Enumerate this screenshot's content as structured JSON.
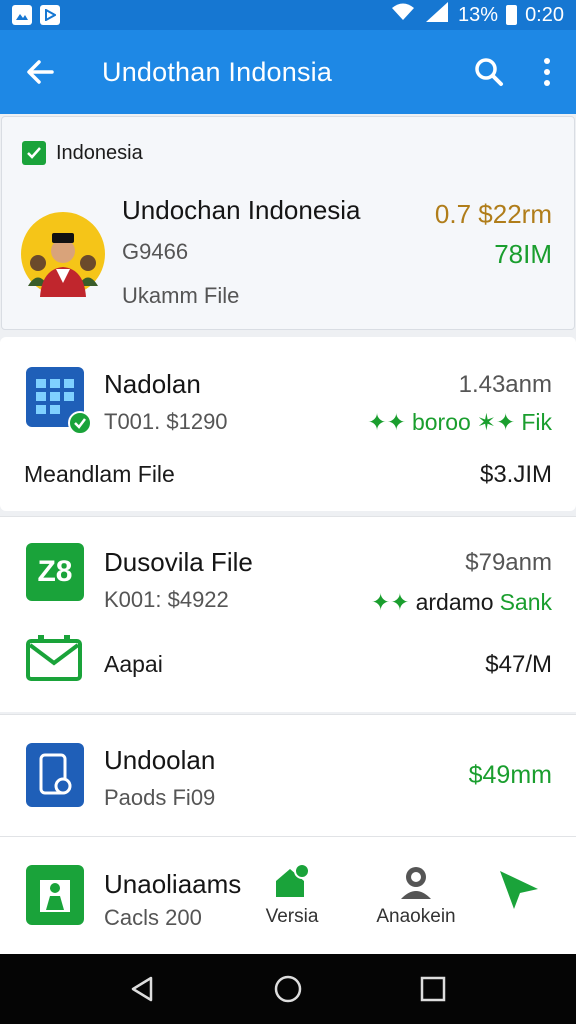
{
  "status_bar": {
    "battery": "13%",
    "time": "0:20"
  },
  "app_bar": {
    "title": "Undothan Indonsia"
  },
  "featured": {
    "checkbox_label": "Indonesia",
    "title": "Undochan Indonesia",
    "code": "G9466",
    "subtitle": "Ukamm File",
    "price": "0.7 $22rm",
    "size": "78IM"
  },
  "items": [
    {
      "title": "Nadolan",
      "code": "T001. $1290",
      "price": "1.43anm",
      "rating_text": "boroo",
      "rating_suffix": "Fik",
      "file_label": "Meandlam File",
      "file_value": "$3.JIM"
    },
    {
      "title": "Dusovila File",
      "code": "K001: $4922",
      "price": "$79anm",
      "rating_text": "ardamo",
      "rating_suffix": "Sank",
      "sub_label": "Aapai",
      "sub_value": "$47/M",
      "icon_text": "Z8"
    },
    {
      "title": "Undoolan",
      "code": "Paods Fi09",
      "price": "$49mm"
    },
    {
      "title": "Unaoliaams",
      "code": "Cacls 200",
      "action1": "Versia",
      "action2": "Anaokein"
    }
  ],
  "colors": {
    "primary": "#1e88e5",
    "status": "#1677d2",
    "green": "#1a9e2e",
    "gold": "#b07d1a"
  }
}
